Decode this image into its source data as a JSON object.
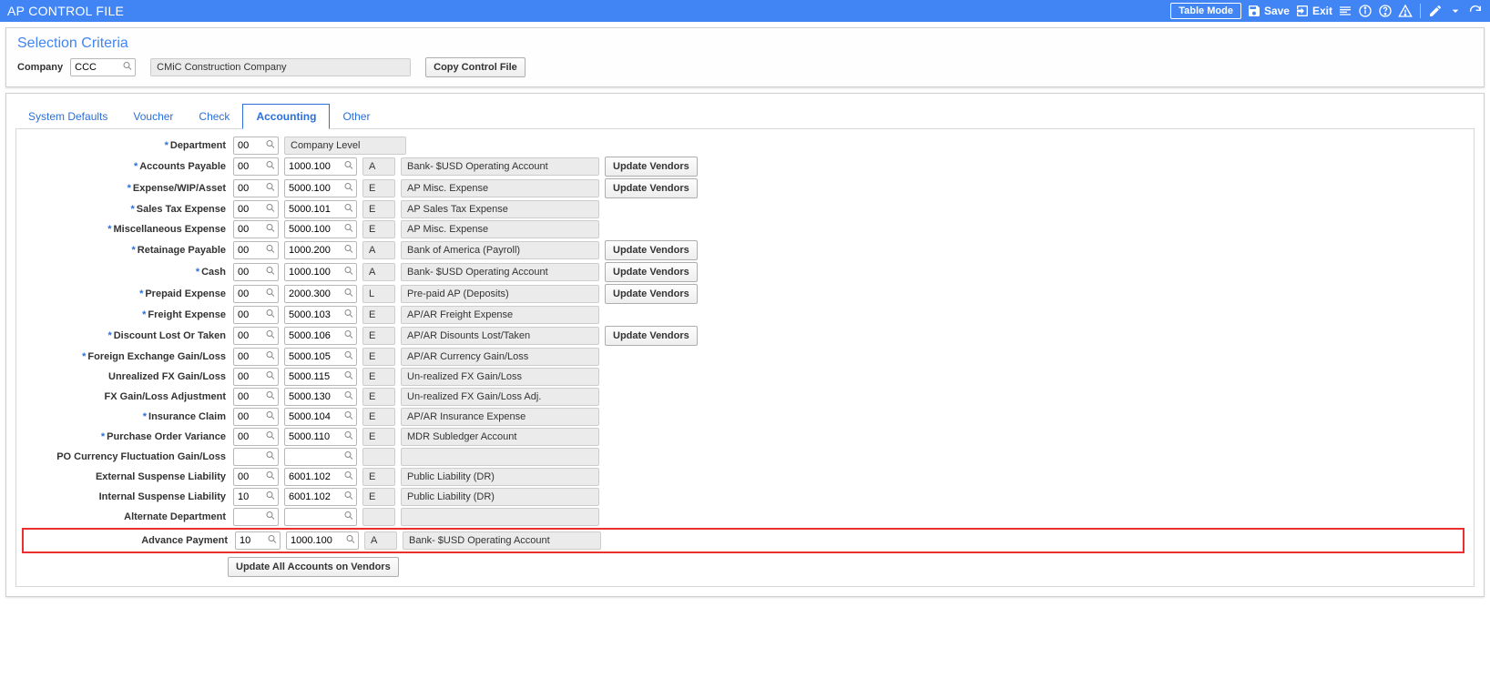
{
  "header": {
    "title": "AP CONTROL FILE",
    "table_mode": "Table Mode",
    "save": "Save",
    "exit": "Exit"
  },
  "selection": {
    "title": "Selection Criteria",
    "company_label": "Company",
    "company_code": "CCC",
    "company_name": "CMiC Construction Company",
    "copy_btn": "Copy Control File"
  },
  "tabs": {
    "system_defaults": "System Defaults",
    "voucher": "Voucher",
    "check": "Check",
    "accounting": "Accounting",
    "other": "Other"
  },
  "labels": {
    "department": "Department",
    "accounts_payable": "Accounts Payable",
    "expense_wip_asset": "Expense/WIP/Asset",
    "sales_tax_expense": "Sales Tax Expense",
    "misc_expense": "Miscellaneous Expense",
    "retainage_payable": "Retainage Payable",
    "cash": "Cash",
    "prepaid_expense": "Prepaid Expense",
    "freight_expense": "Freight Expense",
    "discount_lost_taken": "Discount Lost Or Taken",
    "fx_gain_loss": "Foreign Exchange Gain/Loss",
    "unrealized_fx": "Unrealized FX Gain/Loss",
    "fx_adjustment": "FX Gain/Loss Adjustment",
    "insurance_claim": "Insurance Claim",
    "po_variance": "Purchase Order Variance",
    "po_currency_fluct": "PO Currency Fluctuation Gain/Loss",
    "ext_suspense": "External Suspense Liability",
    "int_suspense": "Internal Suspense Liability",
    "alt_department": "Alternate Department",
    "advance_payment": "Advance Payment"
  },
  "buttons": {
    "update_vendors": "Update Vendors",
    "update_all": "Update All Accounts on Vendors"
  },
  "rows": {
    "department": {
      "dept": "00",
      "desc": "Company Level"
    },
    "accounts_payable": {
      "dept": "00",
      "acct": "1000.100",
      "type": "A",
      "desc": "Bank- $USD Operating Account"
    },
    "expense_wip_asset": {
      "dept": "00",
      "acct": "5000.100",
      "type": "E",
      "desc": "AP Misc. Expense"
    },
    "sales_tax_expense": {
      "dept": "00",
      "acct": "5000.101",
      "type": "E",
      "desc": "AP Sales Tax Expense"
    },
    "misc_expense": {
      "dept": "00",
      "acct": "5000.100",
      "type": "E",
      "desc": "AP Misc. Expense"
    },
    "retainage_payable": {
      "dept": "00",
      "acct": "1000.200",
      "type": "A",
      "desc": "Bank of America (Payroll)"
    },
    "cash": {
      "dept": "00",
      "acct": "1000.100",
      "type": "A",
      "desc": "Bank- $USD Operating Account"
    },
    "prepaid_expense": {
      "dept": "00",
      "acct": "2000.300",
      "type": "L",
      "desc": "Pre-paid AP (Deposits)"
    },
    "freight_expense": {
      "dept": "00",
      "acct": "5000.103",
      "type": "E",
      "desc": "AP/AR Freight Expense"
    },
    "discount_lost_taken": {
      "dept": "00",
      "acct": "5000.106",
      "type": "E",
      "desc": "AP/AR Disounts Lost/Taken"
    },
    "fx_gain_loss": {
      "dept": "00",
      "acct": "5000.105",
      "type": "E",
      "desc": "AP/AR Currency Gain/Loss"
    },
    "unrealized_fx": {
      "dept": "00",
      "acct": "5000.115",
      "type": "E",
      "desc": "Un-realized FX Gain/Loss"
    },
    "fx_adjustment": {
      "dept": "00",
      "acct": "5000.130",
      "type": "E",
      "desc": "Un-realized FX Gain/Loss Adj."
    },
    "insurance_claim": {
      "dept": "00",
      "acct": "5000.104",
      "type": "E",
      "desc": "AP/AR Insurance Expense"
    },
    "po_variance": {
      "dept": "00",
      "acct": "5000.110",
      "type": "E",
      "desc": "MDR Subledger Account"
    },
    "po_currency_fluct": {
      "dept": "",
      "acct": "",
      "type": "",
      "desc": ""
    },
    "ext_suspense": {
      "dept": "00",
      "acct": "6001.102",
      "type": "E",
      "desc": "Public Liability (DR)"
    },
    "int_suspense": {
      "dept": "10",
      "acct": "6001.102",
      "type": "E",
      "desc": "Public Liability (DR)"
    },
    "alt_department": {
      "dept": "",
      "acct": "",
      "type": "",
      "desc": ""
    },
    "advance_payment": {
      "dept": "10",
      "acct": "1000.100",
      "type": "A",
      "desc": "Bank- $USD Operating Account"
    }
  }
}
